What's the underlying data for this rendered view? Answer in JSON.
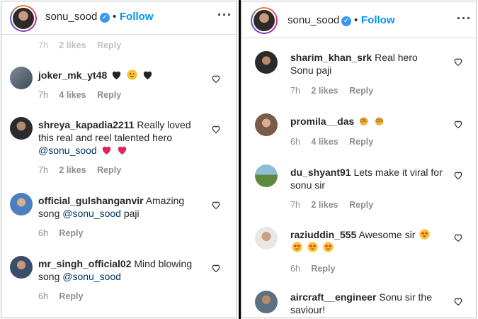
{
  "left": {
    "header": {
      "username": "sonu_sood",
      "follow": "Follow",
      "separator": "•"
    },
    "top_partial": {
      "time": "7h",
      "likes": "2 likes",
      "reply": "Reply"
    },
    "comments": [
      {
        "user": "joker_mk_yt48",
        "text": "",
        "mention": "",
        "tail": "",
        "time": "7h",
        "likes": "4 likes",
        "reply": "Reply"
      },
      {
        "user": "shreya_kapadia2211",
        "text": "Really loved this real and reel talented hero",
        "mention": "@sonu_sood",
        "tail": "",
        "time": "7h",
        "likes": "2 likes",
        "reply": "Reply"
      },
      {
        "user": "official_gulshanganvir",
        "text": "Amazing song",
        "mention": "@sonu_sood",
        "tail": "paji",
        "time": "6h",
        "likes": "",
        "reply": "Reply"
      },
      {
        "user": "mr_singh_official02",
        "text": "Mind blowing song",
        "mention": "@sonu_sood",
        "tail": "",
        "time": "6h",
        "likes": "",
        "reply": "Reply"
      }
    ]
  },
  "right": {
    "header": {
      "username": "sonu_sood",
      "follow": "Follow",
      "separator": "•"
    },
    "comments": [
      {
        "user": "sharim_khan_srk",
        "text": "Real hero Sonu paji",
        "time": "7h",
        "likes": "2 likes",
        "reply": "Reply"
      },
      {
        "user": "promila__das",
        "text": "",
        "time": "6h",
        "likes": "4 likes",
        "reply": "Reply"
      },
      {
        "user": "du_shyant91",
        "text": "Lets make it viral for sonu sir",
        "time": "7h",
        "likes": "2 likes",
        "reply": "Reply"
      },
      {
        "user": "raziuddin_555",
        "text": "Awesome sir",
        "time": "6h",
        "likes": "",
        "reply": "Reply"
      },
      {
        "user": "aircraft__engineer",
        "text": "Sonu sir the saviour!",
        "time": "",
        "likes": "",
        "reply": ""
      }
    ]
  },
  "icons": {
    "heart": "heart-outline-icon",
    "verified": "verified-badge-icon",
    "more": "more-options-icon",
    "black_heart": "black-heart-emoji",
    "red_heart": "red-heart-emoji",
    "ok_hand": "ok-hand-emoji",
    "heart_eyes": "heart-eyes-emoji",
    "winking": "winking-face-emoji"
  },
  "colors": {
    "follow": "#0095f6",
    "mention": "#00376b",
    "meta": "#8e8e8e",
    "verified": "#3897f0"
  }
}
